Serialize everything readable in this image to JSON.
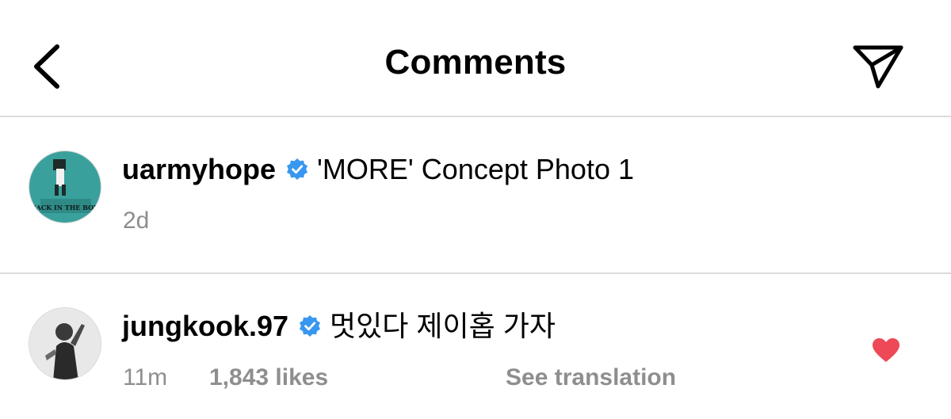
{
  "header": {
    "title": "Comments"
  },
  "caption": {
    "username": "uarmyhope",
    "verified": true,
    "text": "'MORE' Concept Photo 1",
    "time": "2d",
    "avatar_text": "JACK IN THE BOX",
    "avatar_color": "#3aa09c"
  },
  "comment": {
    "username": "jungkook.97",
    "verified": true,
    "text": "멋있다 제이홉 가자",
    "time": "11m",
    "likes": "1,843 likes",
    "see_translation": "See translation",
    "liked": true,
    "heart_color": "#ed4956"
  },
  "colors": {
    "verified_blue": "#3897f0",
    "meta_gray": "#8e8e8e",
    "divider": "#dbdbdb"
  }
}
